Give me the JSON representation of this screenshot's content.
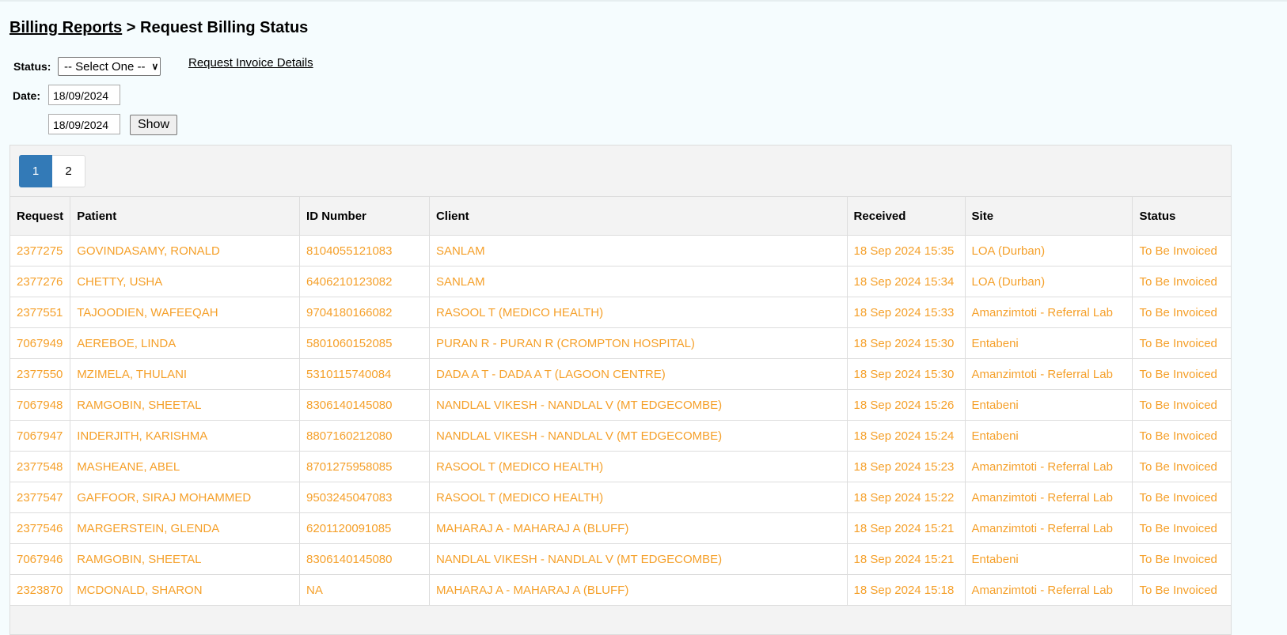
{
  "breadcrumb": {
    "parent": "Billing Reports",
    "separator": " > ",
    "current": "Request Billing Status"
  },
  "filters": {
    "status_label": "Status:",
    "status_value": "-- Select One --",
    "invoice_link": "Request Invoice Details",
    "date_label": "Date:",
    "date_from": "18/09/2024",
    "date_to": "18/09/2024",
    "show_button": "Show"
  },
  "pagination": {
    "pages": [
      "1",
      "2"
    ],
    "active": "1"
  },
  "table": {
    "columns": [
      "Request",
      "Patient",
      "ID Number",
      "Client",
      "Received",
      "Site",
      "Status"
    ],
    "rows": [
      [
        "2377275",
        "GOVINDASAMY, RONALD",
        "8104055121083",
        "SANLAM",
        "18 Sep 2024 15:35",
        "LOA (Durban)",
        "To Be Invoiced"
      ],
      [
        "2377276",
        "CHETTY, USHA",
        "6406210123082",
        "SANLAM",
        "18 Sep 2024 15:34",
        "LOA (Durban)",
        "To Be Invoiced"
      ],
      [
        "2377551",
        "TAJOODIEN, WAFEEQAH",
        "9704180166082",
        "RASOOL T (MEDICO HEALTH)",
        "18 Sep 2024 15:33",
        "Amanzimtoti - Referral Lab",
        "To Be Invoiced"
      ],
      [
        "7067949",
        "AEREBOE, LINDA",
        "5801060152085",
        "PURAN R - PURAN R (CROMPTON HOSPITAL)",
        "18 Sep 2024 15:30",
        "Entabeni",
        "To Be Invoiced"
      ],
      [
        "2377550",
        "MZIMELA, THULANI",
        "5310115740084",
        "DADA A T - DADA A T (LAGOON CENTRE)",
        "18 Sep 2024 15:30",
        "Amanzimtoti - Referral Lab",
        "To Be Invoiced"
      ],
      [
        "7067948",
        "RAMGOBIN, SHEETAL",
        "8306140145080",
        "NANDLAL VIKESH - NANDLAL V (MT EDGECOMBE)",
        "18 Sep 2024 15:26",
        "Entabeni",
        "To Be Invoiced"
      ],
      [
        "7067947",
        "INDERJITH, KARISHMA",
        "8807160212080",
        "NANDLAL VIKESH - NANDLAL V (MT EDGECOMBE)",
        "18 Sep 2024 15:24",
        "Entabeni",
        "To Be Invoiced"
      ],
      [
        "2377548",
        "MASHEANE, ABEL",
        "8701275958085",
        "RASOOL T (MEDICO HEALTH)",
        "18 Sep 2024 15:23",
        "Amanzimtoti - Referral Lab",
        "To Be Invoiced"
      ],
      [
        "2377547",
        "GAFFOOR, SIRAJ MOHAMMED",
        "9503245047083",
        "RASOOL T (MEDICO HEALTH)",
        "18 Sep 2024 15:22",
        "Amanzimtoti - Referral Lab",
        "To Be Invoiced"
      ],
      [
        "2377546",
        "MARGERSTEIN, GLENDA",
        "6201120091085",
        "MAHARAJ A - MAHARAJ A (BLUFF)",
        "18 Sep 2024 15:21",
        "Amanzimtoti - Referral Lab",
        "To Be Invoiced"
      ],
      [
        "7067946",
        "RAMGOBIN, SHEETAL",
        "8306140145080",
        "NANDLAL VIKESH - NANDLAL V (MT EDGECOMBE)",
        "18 Sep 2024 15:21",
        "Entabeni",
        "To Be Invoiced"
      ],
      [
        "2323870",
        "MCDONALD, SHARON",
        "NA",
        "MAHARAJ A - MAHARAJ A (BLUFF)",
        "18 Sep 2024 15:18",
        "Amanzimtoti - Referral Lab",
        "To Be Invoiced"
      ]
    ]
  },
  "colors": {
    "row_text": "#f5a02a",
    "active_page": "#337ab7"
  }
}
